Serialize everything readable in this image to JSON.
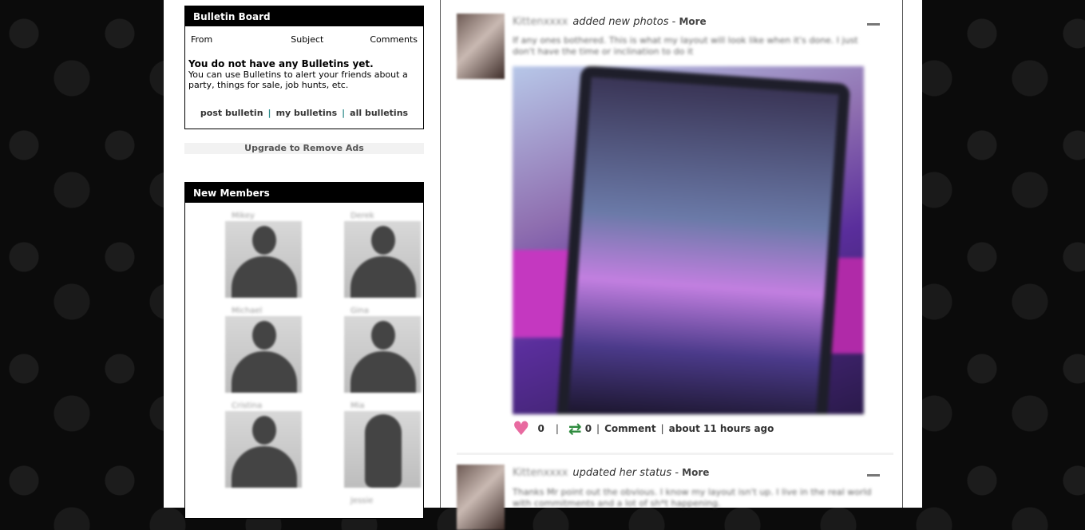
{
  "bulletin": {
    "title": "Bulletin Board",
    "col_from": "From",
    "col_subject": "Subject",
    "col_comments": "Comments",
    "empty_title": "You do not have any Bulletins yet.",
    "empty_text": "You can use Bulletins to alert your friends about a party, things for sale, job hunts, etc.",
    "link_post": "post bulletin",
    "link_mine": "my bulletins",
    "link_all": "all bulletins",
    "sep": "|"
  },
  "upgrade": "Upgrade to Remove Ads",
  "new_members": {
    "title": "New Members",
    "members": [
      "Mikey",
      "Derek",
      "Michael",
      "Gina",
      "Cristina",
      "Mia",
      "Jessie"
    ]
  },
  "feed": {
    "post1": {
      "user": "Kittenxxxx",
      "action": "added new photos",
      "dash": " - ",
      "more": "More",
      "text": "If any ones bothered. This is what my layout will look like when it's done. I just don't have the time or inclination to do it",
      "likes": "0",
      "reposts": "0",
      "comment": "Comment",
      "time": "about 11 hours ago",
      "sep": "|"
    },
    "post2": {
      "user": "Kittenxxxx",
      "action": "updated her status",
      "dash": " - ",
      "more": "More",
      "text": "Thanks Mr point out the obvious. I know my layout isn't up. I live in the real world with commitments and a lot of sh*t happening."
    }
  },
  "colors": {
    "heart": "#e86aa0",
    "repost": "#2e8b3e",
    "separator_link": "#2b8a8a"
  },
  "icons": [
    "heart-icon",
    "repost-icon",
    "collapse-icon"
  ]
}
